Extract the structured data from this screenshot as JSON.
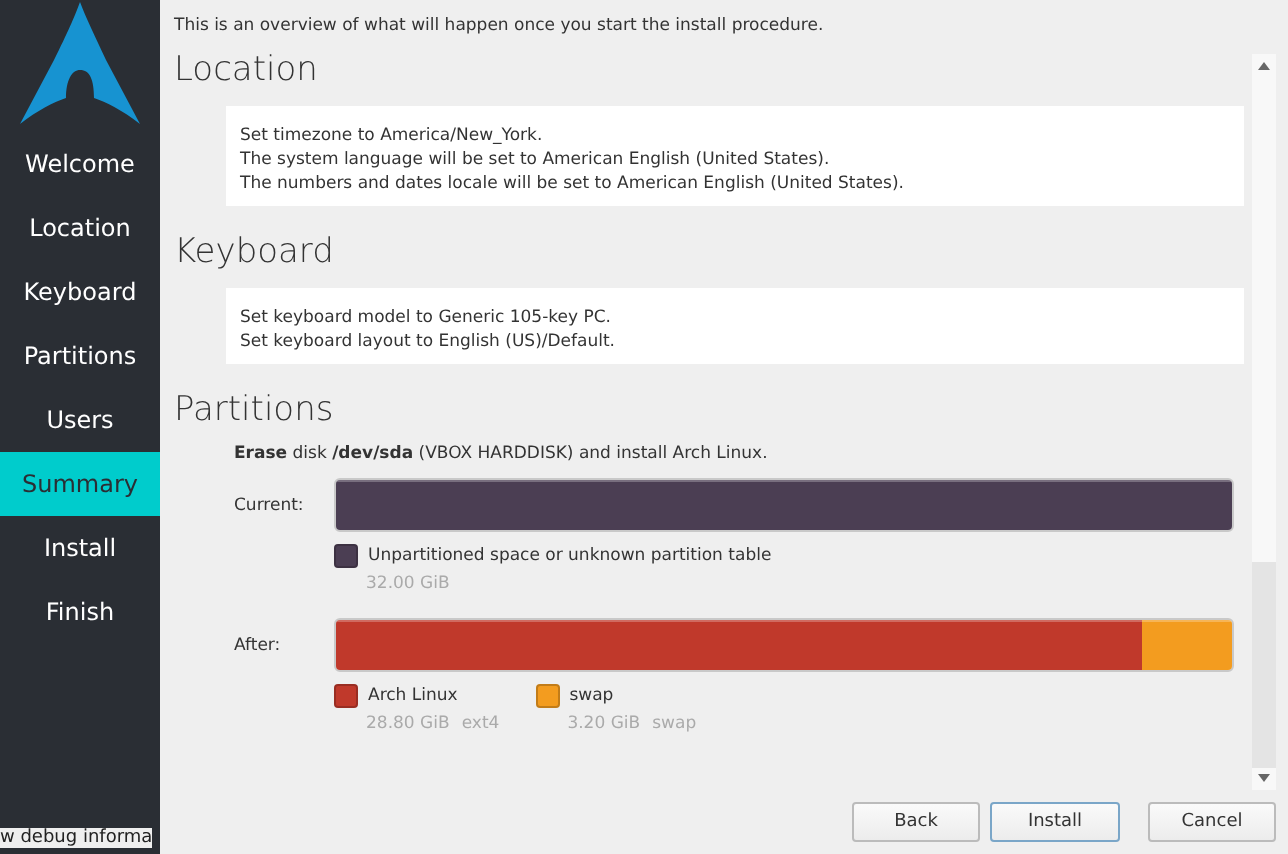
{
  "sidebar": {
    "items": [
      {
        "label": "Welcome",
        "selected": false
      },
      {
        "label": "Location",
        "selected": false
      },
      {
        "label": "Keyboard",
        "selected": false
      },
      {
        "label": "Partitions",
        "selected": false
      },
      {
        "label": "Users",
        "selected": false
      },
      {
        "label": "Summary",
        "selected": true
      },
      {
        "label": "Install",
        "selected": false
      },
      {
        "label": "Finish",
        "selected": false
      }
    ],
    "debug_link": "w debug informa"
  },
  "intro": "This is an overview of what will happen once you start the install procedure.",
  "sections": [
    {
      "kind": "text",
      "title": "Location",
      "lines": [
        "Set timezone to America/New_York.",
        "The system language will be set to American English (United States).",
        "The numbers and dates locale will be set to American English (United States)."
      ]
    },
    {
      "kind": "text",
      "title": "Keyboard",
      "lines": [
        "Set keyboard model to Generic 105-key PC.",
        "Set keyboard layout to English (US)/Default."
      ]
    },
    {
      "kind": "partitions",
      "title": "Partitions",
      "summary": "**Erase** disk **/dev/sda** (VBOX HARDDISK) and install Arch Linux.",
      "bars": [
        {
          "label": "Current:",
          "segments": [
            {
              "name": "Unpartitioned space or unknown partition table",
              "color": "#4b3e53",
              "level": 1,
              "size": "32.00 GiB"
            }
          ]
        },
        {
          "label": "After:",
          "segments": [
            {
              "name": "Arch Linux",
              "color": "#c0392b",
              "level": 0.9,
              "size": "28.80 GiB",
              "filesystem": "ext4"
            },
            {
              "name": "swap",
              "color": "#f39c1f",
              "level": 0.1,
              "size": "3.20 GiB",
              "filesystem": "swap"
            }
          ]
        }
      ]
    }
  ],
  "buttons": [
    {
      "label": "Back",
      "selected": false
    },
    {
      "label": "Install",
      "selected": true
    },
    {
      "label": "Cancel",
      "selected": false
    }
  ]
}
